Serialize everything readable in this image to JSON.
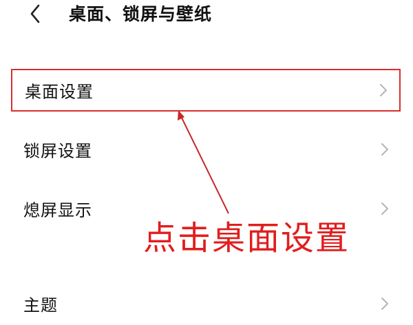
{
  "header": {
    "title": "桌面、锁屏与壁纸",
    "back_icon": "chevron-left-icon"
  },
  "settings_items": [
    {
      "label": "桌面设置",
      "icon": "chevron-right-icon",
      "highlighted": true
    },
    {
      "label": "锁屏设置",
      "icon": "chevron-right-icon",
      "highlighted": false
    },
    {
      "label": "熄屏显示",
      "icon": "chevron-right-icon",
      "highlighted": false
    },
    {
      "label": "主题",
      "icon": "chevron-right-icon",
      "highlighted": false
    }
  ],
  "annotation": {
    "text": "点击桌面设置",
    "color": "#e21d1d",
    "highlight_color": "#d92d2d"
  }
}
